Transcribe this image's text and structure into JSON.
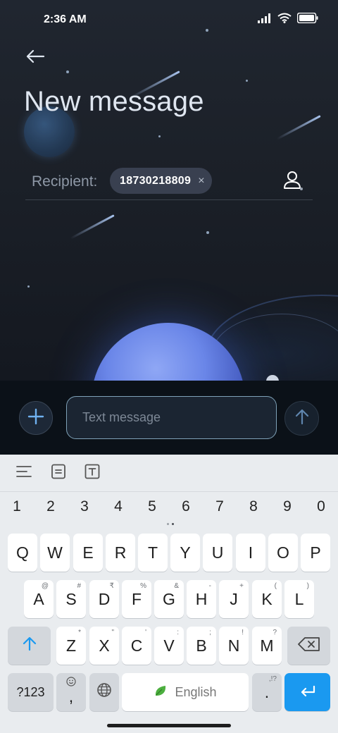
{
  "status_bar": {
    "time": "2:36 AM"
  },
  "header": {
    "title": "New message"
  },
  "recipient": {
    "label": "Recipient:",
    "chip": "18730218809",
    "chip_remove": "×"
  },
  "compose": {
    "placeholder": "Text message"
  },
  "keyboard": {
    "numbers": [
      "1",
      "2",
      "3",
      "4",
      "5",
      "6",
      "7",
      "8",
      "9",
      "0"
    ],
    "row1": [
      "Q",
      "W",
      "E",
      "R",
      "T",
      "Y",
      "U",
      "I",
      "O",
      "P"
    ],
    "row2": [
      "A",
      "S",
      "D",
      "F",
      "G",
      "H",
      "J",
      "K",
      "L"
    ],
    "row2_hints": [
      "@",
      "#",
      "₹",
      "%",
      "&",
      "-",
      "+",
      "(",
      ")"
    ],
    "row3": [
      "Z",
      "X",
      "C",
      "V",
      "B",
      "N",
      "M"
    ],
    "row3_hints": [
      "*",
      "\"",
      "'",
      ":",
      ";",
      "!",
      "?"
    ],
    "symbols_key": "?123",
    "comma_key": ",",
    "space_label": "English",
    "period_key": ".",
    "period_hint": ",!?"
  },
  "colors": {
    "accent": "#1a99f0",
    "space_bg": "#1c2129",
    "compose_bg": "#0b1118",
    "input_border": "#7fa2b8"
  },
  "icons": [
    "back-arrow-icon",
    "signal-icon",
    "wifi-icon",
    "battery-icon",
    "contact-icon",
    "plus-icon",
    "send-arrow-icon",
    "menu-lines-icon",
    "clipboard-icon",
    "text-format-icon",
    "shift-icon",
    "backspace-icon",
    "emoji-icon",
    "globe-icon",
    "leaf-icon",
    "enter-icon"
  ]
}
